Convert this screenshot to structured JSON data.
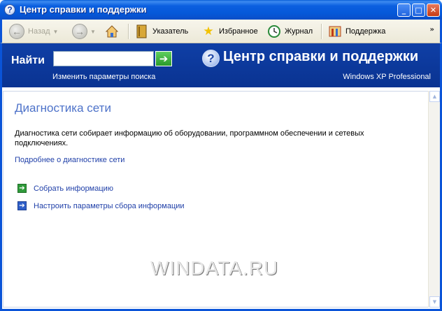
{
  "window": {
    "title": "Центр справки и поддержки",
    "minimize_glyph": "_",
    "maximize_glyph": "□",
    "close_glyph": "✕"
  },
  "toolbar": {
    "back_label": "Назад",
    "index_label": "Указатель",
    "favorites_label": "Избранное",
    "history_label": "Журнал",
    "support_label": "Поддержка"
  },
  "search": {
    "label": "Найти",
    "value": "",
    "placeholder": "",
    "options_link": "Изменить параметры поиска"
  },
  "header": {
    "title": "Центр справки и поддержки",
    "edition": "Windows XP Professional"
  },
  "main": {
    "page_title": "Диагностика сети",
    "description": "Диагностика сети собирает информацию об оборудовании, программном обеспечении и сетевых подключениях.",
    "more_link": "Подробнее о диагностике сети",
    "tasks": [
      {
        "label": "Собрать информацию",
        "icon": "green-arrow-icon"
      },
      {
        "label": "Настроить параметры сбора информации",
        "icon": "blue-arrow-icon"
      }
    ]
  },
  "watermark": "WINDATA.RU",
  "colors": {
    "titlebar": "#0558d8",
    "band": "#0a3391",
    "link": "#1f3fa8",
    "page_title": "#4d72c9"
  }
}
